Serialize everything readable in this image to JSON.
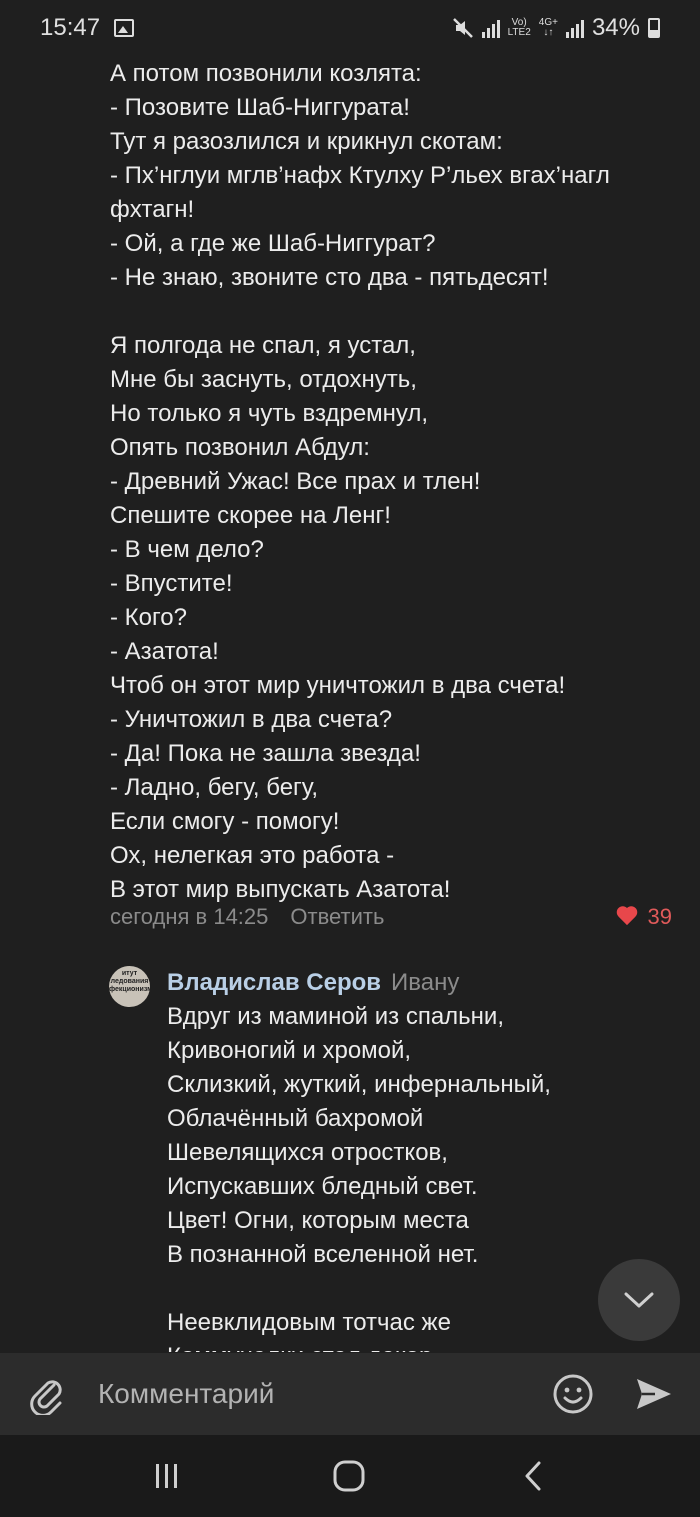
{
  "status_bar": {
    "time": "15:47",
    "network": "4G+",
    "battery": "34%",
    "icons": [
      "image-icon",
      "mute-icon",
      "signal-icon",
      "volte-icon",
      "battery-icon"
    ]
  },
  "comment1": {
    "lines": [
      "А потом позвонили козлята:",
      "- Позовите Шаб-Ниггурата!",
      "Тут я разозлился и крикнул скотам:",
      "- Пх’нглуи мглв’нафх Ктулху Р’льех вгах’нагл",
      "фхтагн!",
      "- Ой, а где же Шаб-Ниггурат?",
      "- Не знаю, звоните сто два - пятьдесят!",
      "",
      "Я полгода не спал, я устал,",
      "Мне бы заснуть, отдохнуть,",
      "Но только я чуть вздремнул,",
      "Опять позвонил Абдул:",
      "- Древний Ужас! Все прах и тлен!",
      "Спешите скорее на Ленг!",
      "- В чем дело?",
      "- Впустите!",
      "- Кого?",
      "- Азатота!",
      "Чтоб он этот мир уничтожил в два счета!",
      "- Уничтожил в два счета?",
      "- Да! Пока не зашла звезда!",
      "- Ладно, бегу, бегу,",
      "Если смогу - помогу!",
      "Ох, нелегкая это работа -",
      "В этот мир выпускать Азатота!"
    ],
    "timestamp": "сегодня в 14:25",
    "reply_label": "Ответить",
    "likes": "39"
  },
  "comment2": {
    "author": "Владислав Серов",
    "reply_to": "Ивану",
    "avatar_text": "итут ледования фекционизм",
    "lines": [
      "Вдруг из маминой из спальни,",
      "Кривоногий и хромой,",
      "Склизкий, жуткий, инфернальный,",
      "Облачённый бахромой",
      "Шевелящихся отростков,",
      "Испускавших бледный свет.",
      "Цвет! Огни, которым места",
      "В познанной вселенной нет.",
      "",
      "Неевклидовым тотчас же",
      "Коммуналки стал декор"
    ]
  },
  "input": {
    "placeholder": "Комментарий"
  },
  "colors": {
    "background": "#1f1f1f",
    "author": "#b9cfe6",
    "like": "#e8474b",
    "muted": "#8b8b8b"
  }
}
